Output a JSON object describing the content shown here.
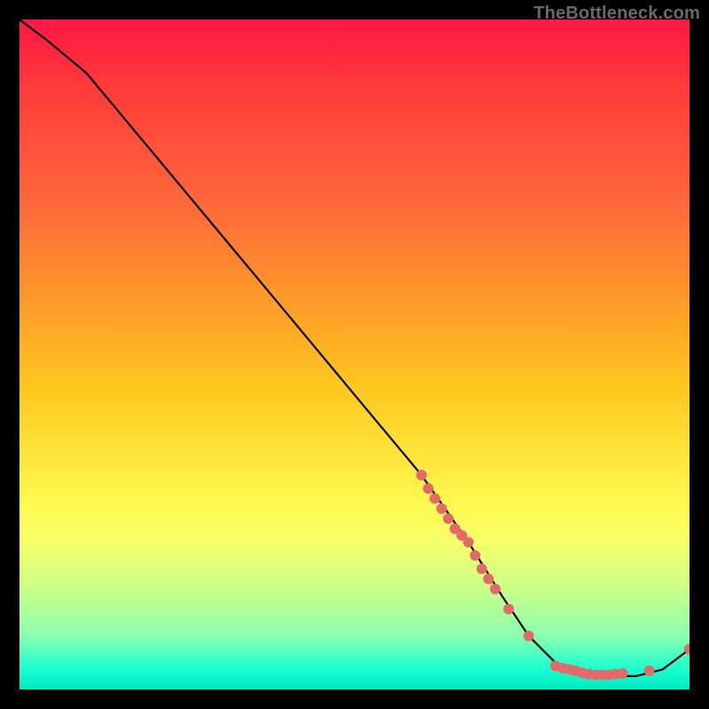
{
  "watermark": "TheBottleneck.com",
  "chart_data": {
    "type": "line",
    "title": "",
    "xlabel": "",
    "ylabel": "",
    "xlim": [
      0,
      100
    ],
    "ylim": [
      0,
      100
    ],
    "series": [
      {
        "name": "bottleneck-curve",
        "x": [
          0,
          4,
          10,
          20,
          30,
          40,
          50,
          60,
          67,
          72,
          76,
          80,
          84,
          88,
          92,
          96,
          100
        ],
        "y": [
          100,
          97,
          92,
          80,
          68,
          56,
          44,
          32,
          22,
          14,
          8,
          4,
          2,
          2,
          2,
          3,
          6
        ]
      }
    ],
    "highlight_points": {
      "name": "scatter-dots",
      "color": "#e46a6a",
      "points": [
        {
          "x": 60,
          "y": 32
        },
        {
          "x": 61,
          "y": 30
        },
        {
          "x": 62,
          "y": 28.5
        },
        {
          "x": 63,
          "y": 27
        },
        {
          "x": 64,
          "y": 25.5
        },
        {
          "x": 65,
          "y": 24
        },
        {
          "x": 66,
          "y": 23
        },
        {
          "x": 67,
          "y": 22
        },
        {
          "x": 68,
          "y": 20
        },
        {
          "x": 69,
          "y": 18
        },
        {
          "x": 70,
          "y": 16.5
        },
        {
          "x": 71,
          "y": 15
        },
        {
          "x": 73,
          "y": 12
        },
        {
          "x": 76,
          "y": 8
        },
        {
          "x": 80,
          "y": 3.5
        },
        {
          "x": 81,
          "y": 3.2
        },
        {
          "x": 82,
          "y": 3
        },
        {
          "x": 83,
          "y": 2.8
        },
        {
          "x": 84,
          "y": 2.5
        },
        {
          "x": 85,
          "y": 2.3
        },
        {
          "x": 86,
          "y": 2.2
        },
        {
          "x": 87,
          "y": 2.2
        },
        {
          "x": 88,
          "y": 2.2
        },
        {
          "x": 89,
          "y": 2.3
        },
        {
          "x": 90,
          "y": 2.4
        },
        {
          "x": 94,
          "y": 2.8
        },
        {
          "x": 100,
          "y": 6
        }
      ]
    }
  }
}
